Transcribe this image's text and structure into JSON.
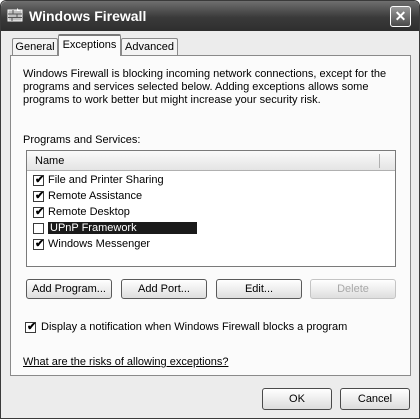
{
  "window": {
    "title": "Windows Firewall",
    "close_glyph": "✕"
  },
  "tabs": [
    {
      "label": "General"
    },
    {
      "label": "Exceptions",
      "active": true
    },
    {
      "label": "Advanced"
    }
  ],
  "description": "Windows Firewall is blocking incoming network connections, except for the programs and services selected below. Adding exceptions allows some programs to work better but might increase your security risk.",
  "programs": {
    "label": "Programs and Services:",
    "column_header": "Name",
    "items": [
      {
        "label": "File and Printer Sharing",
        "checked": true
      },
      {
        "label": "Remote Assistance",
        "checked": true
      },
      {
        "label": "Remote Desktop",
        "checked": true
      },
      {
        "label": "UPnP Framework",
        "checked": false,
        "selected": true
      },
      {
        "label": "Windows Messenger",
        "checked": true
      }
    ]
  },
  "actions": {
    "add_program": "Add Program...",
    "add_port": "Add Port...",
    "edit": "Edit...",
    "delete": "Delete"
  },
  "notification": {
    "label": "Display a notification when Windows Firewall blocks a program",
    "checked": true
  },
  "link": "What are the risks of allowing exceptions?",
  "footer": {
    "ok": "OK",
    "cancel": "Cancel"
  },
  "check_glyph": "✔"
}
